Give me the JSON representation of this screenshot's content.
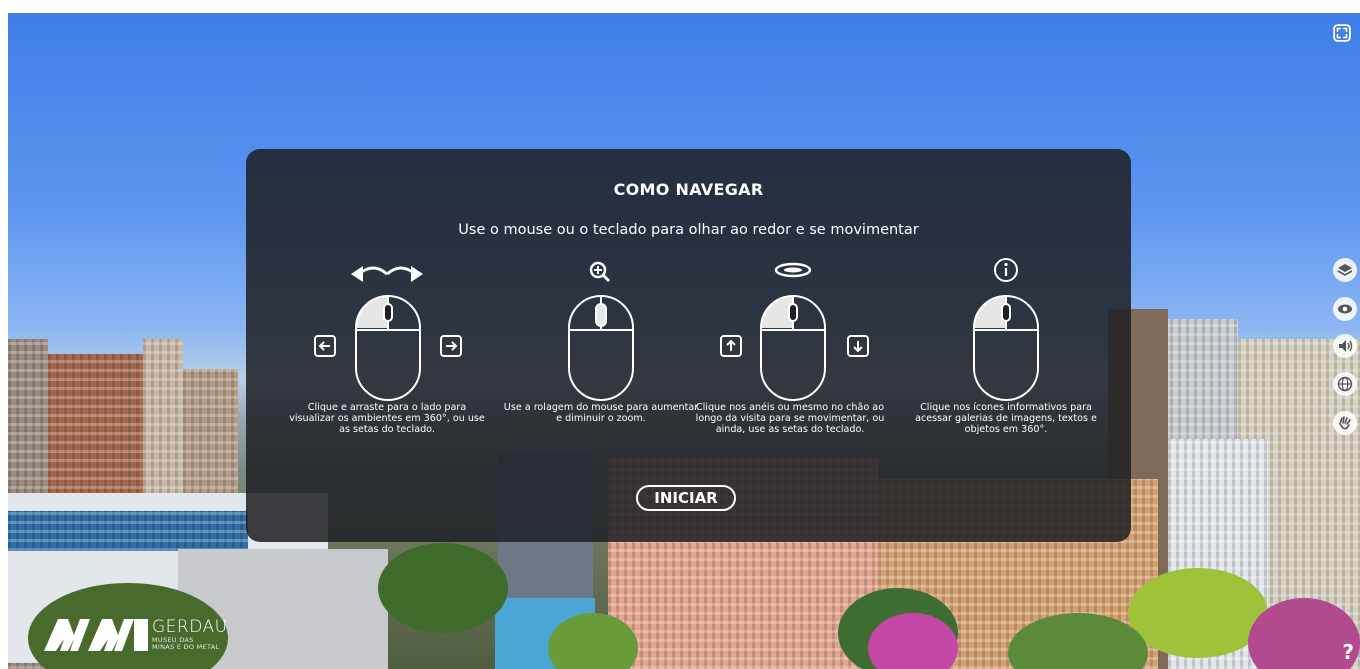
{
  "dialog": {
    "title": "COMO NAVEGAR",
    "subtitle": "Use o mouse ou o teclado para olhar ao redor e se movimentar",
    "instructions": [
      {
        "icon": "mouse-drag-arrows-icon",
        "text": "Clique e arraste para o lado para visualizar os ambientes em 360°, ou use as setas do teclado."
      },
      {
        "icon": "mouse-scroll-zoom-icon",
        "text": "Use a rolagem do mouse para aumentar e diminuir o zoom."
      },
      {
        "icon": "mouse-click-ring-icon",
        "text": "Clique nos anéis ou mesmo no chão ao longo da visita para se movimentar, ou ainda, use as setas do teclado."
      },
      {
        "icon": "mouse-click-info-icon",
        "text": "Clique nos ícones informativos para acessar galerias de imagens, textos e objetos em 360°."
      }
    ],
    "start_label": "INICIAR"
  },
  "toolbar": {
    "icons": [
      "fullscreen-icon",
      "layers-icon",
      "eye-icon",
      "sound-icon",
      "globe-icon",
      "sign-language-icon",
      "help-icon"
    ],
    "help_label": "?"
  },
  "logo": {
    "brand": "GERDAU",
    "subtitle_line1": "MUSEU DAS",
    "subtitle_line2": "MINAS E DO METAL"
  },
  "colors": {
    "panel": "#1e2024",
    "text": "#ffffff",
    "sky": "#3f7ee9"
  }
}
